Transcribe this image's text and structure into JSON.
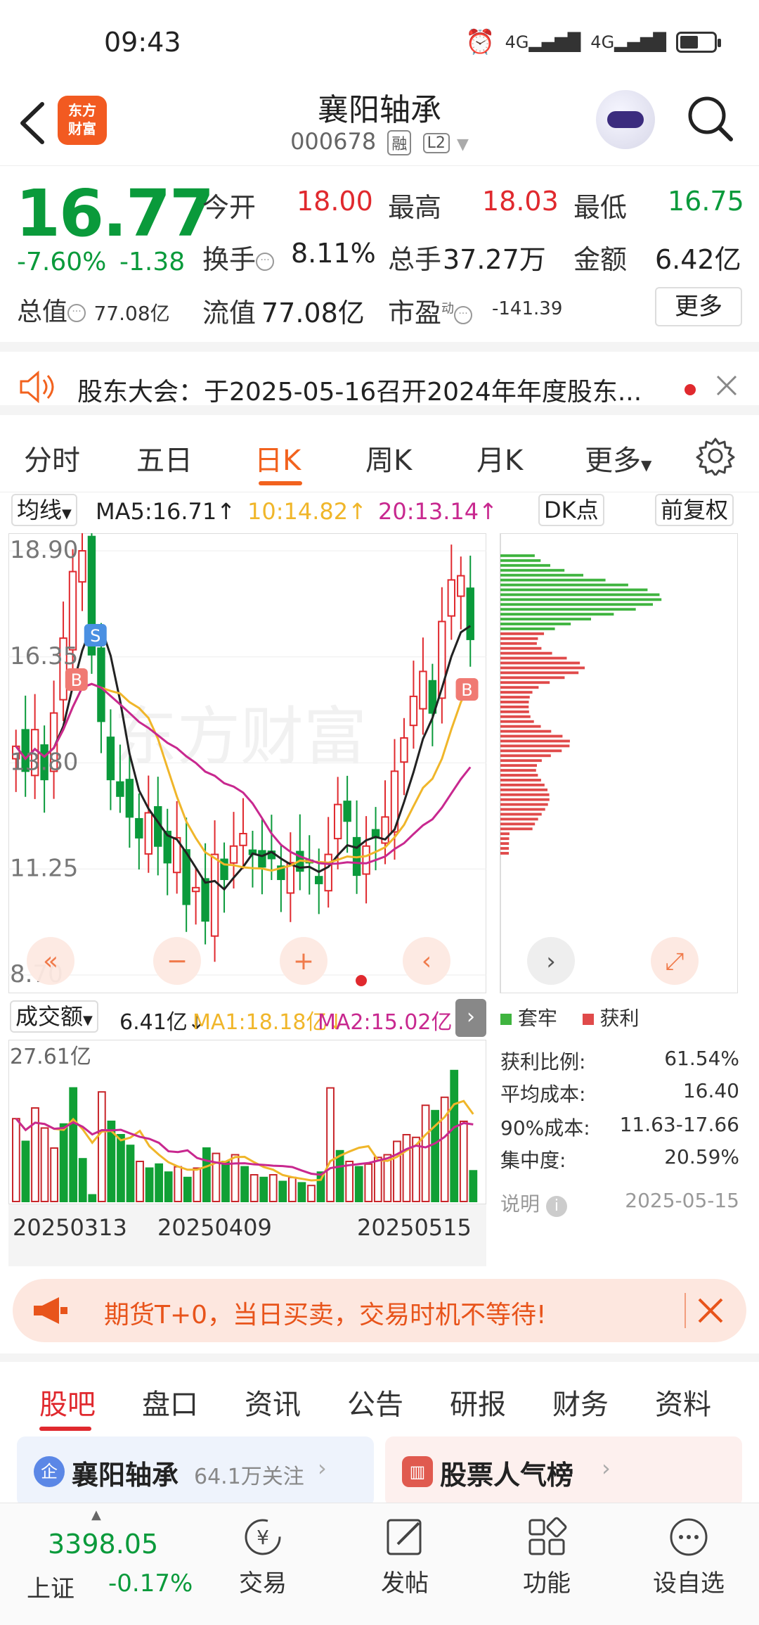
{
  "status_bar": {
    "time": "09:43",
    "net1": "4G",
    "net2": "4G",
    "battery_level": 0.55
  },
  "header": {
    "logo_line1": "东方",
    "logo_line2": "财富",
    "stock_name": "襄阳轴承",
    "stock_code": "000678",
    "tag_margin": "融",
    "tag_level": "L2"
  },
  "quote": {
    "price": "16.77",
    "change_pct": "-7.60%",
    "change_val": "-1.38",
    "open_label": "今开",
    "open": "18.00",
    "high_label": "最高",
    "high": "18.03",
    "low_label": "最低",
    "low": "16.75",
    "turnover_label": "换手",
    "turnover": "8.11%",
    "volume_label": "总手",
    "volume": "37.27万",
    "amount_label": "金额",
    "amount": "6.42亿",
    "mktcap_label": "总值",
    "mktcap": "77.08亿",
    "float_label": "流值",
    "float_cap": "77.08亿",
    "pe_label": "市盈",
    "pe_sup": "动",
    "pe": "-141.39",
    "more_label": "更多"
  },
  "notice": {
    "text": "股东大会：于2025-05-16召开2024年年度股东..."
  },
  "tabs": [
    "分时",
    "五日",
    "日K",
    "周K",
    "月K",
    "更多"
  ],
  "ma_row": {
    "ma_select": "均线",
    "ma5": "MA5:16.71↑",
    "ma10": "10:14.82↑",
    "ma20": "20:13.14↑",
    "dk_point": "DK点",
    "adjust": "前复权"
  },
  "kchart": {
    "y_labels": [
      "18.90",
      "16.35",
      "13.80",
      "11.25",
      "8.70"
    ],
    "sell_marker": "S",
    "buy_marker": "B",
    "watermark": "东方财富"
  },
  "volume": {
    "select": "成交额",
    "value": "6.41亿↓",
    "ma1": "MA1:18.18亿↓",
    "ma2": "MA2:15.02亿↓",
    "max_label": "27.61亿",
    "dates": [
      "20250313",
      "20250409",
      "20250515"
    ]
  },
  "chips": {
    "legend_trapped": "套牢",
    "legend_profit": "获利",
    "profit_ratio_label": "获利比例:",
    "profit_ratio": "61.54%",
    "avg_cost_label": "平均成本:",
    "avg_cost": "16.40",
    "cost90_label": "90%成本:",
    "cost90": "11.63-17.66",
    "concentration_label": "集中度:",
    "concentration": "20.59%",
    "note_label": "说明",
    "date": "2025-05-15"
  },
  "ad": {
    "text": "期货T+0，当日买卖，交易时机不等待!"
  },
  "sub_tabs": [
    "股吧",
    "盘口",
    "资讯",
    "公告",
    "研报",
    "财务",
    "资料"
  ],
  "cards": {
    "left_badge": "企",
    "left_title": "襄阳轴承",
    "left_sub": "64.1万关注",
    "right_title": "股票人气榜"
  },
  "bottom_nav": {
    "index_value": "3398.05",
    "index_name": "上证",
    "index_change": "-0.17%",
    "items": [
      "交易",
      "发帖",
      "功能",
      "设自选"
    ]
  },
  "colors": {
    "up": "#e0292e",
    "down": "#0a9a3b",
    "accent": "#f2621e",
    "ma5": "#222222",
    "ma10": "#f0b62a",
    "ma20": "#c8288f"
  }
}
